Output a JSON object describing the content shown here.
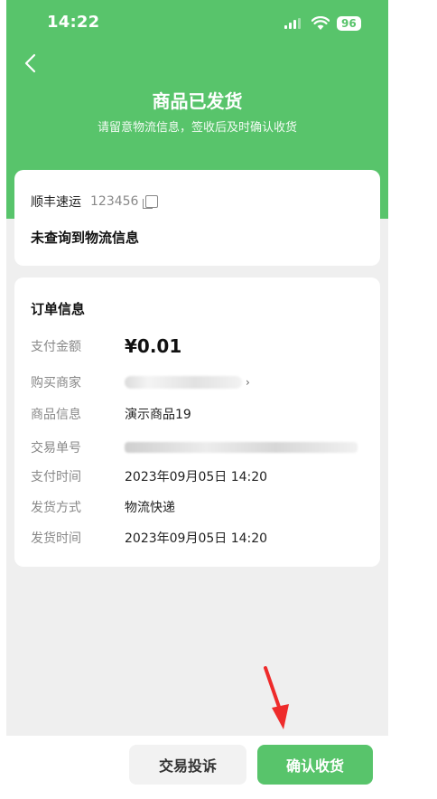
{
  "status_bar": {
    "time": "14:22",
    "battery": "96"
  },
  "header": {
    "title": "商品已发货",
    "subtitle": "请留意物流信息，签收后及时确认收货"
  },
  "shipping": {
    "courier": "顺丰速运",
    "tracking_number": "123456",
    "status_text": "未查询到物流信息"
  },
  "order_info": {
    "title": "订单信息",
    "payment_amount_label": "支付金额",
    "payment_amount": "¥0.01",
    "merchant_label": "购买商家",
    "product_label": "商品信息",
    "product_name": "演示商品19",
    "trade_no_label": "交易单号",
    "pay_time_label": "支付时间",
    "pay_time": "2023年09月05日 14:20",
    "ship_method_label": "发货方式",
    "ship_method": "物流快递",
    "ship_time_label": "发货时间",
    "ship_time": "2023年09月05日 14:20"
  },
  "actions": {
    "complain_label": "交易投诉",
    "confirm_label": "确认收货"
  },
  "colors": {
    "brand": "#58c46b",
    "annotation_arrow": "#ee2b2b"
  }
}
